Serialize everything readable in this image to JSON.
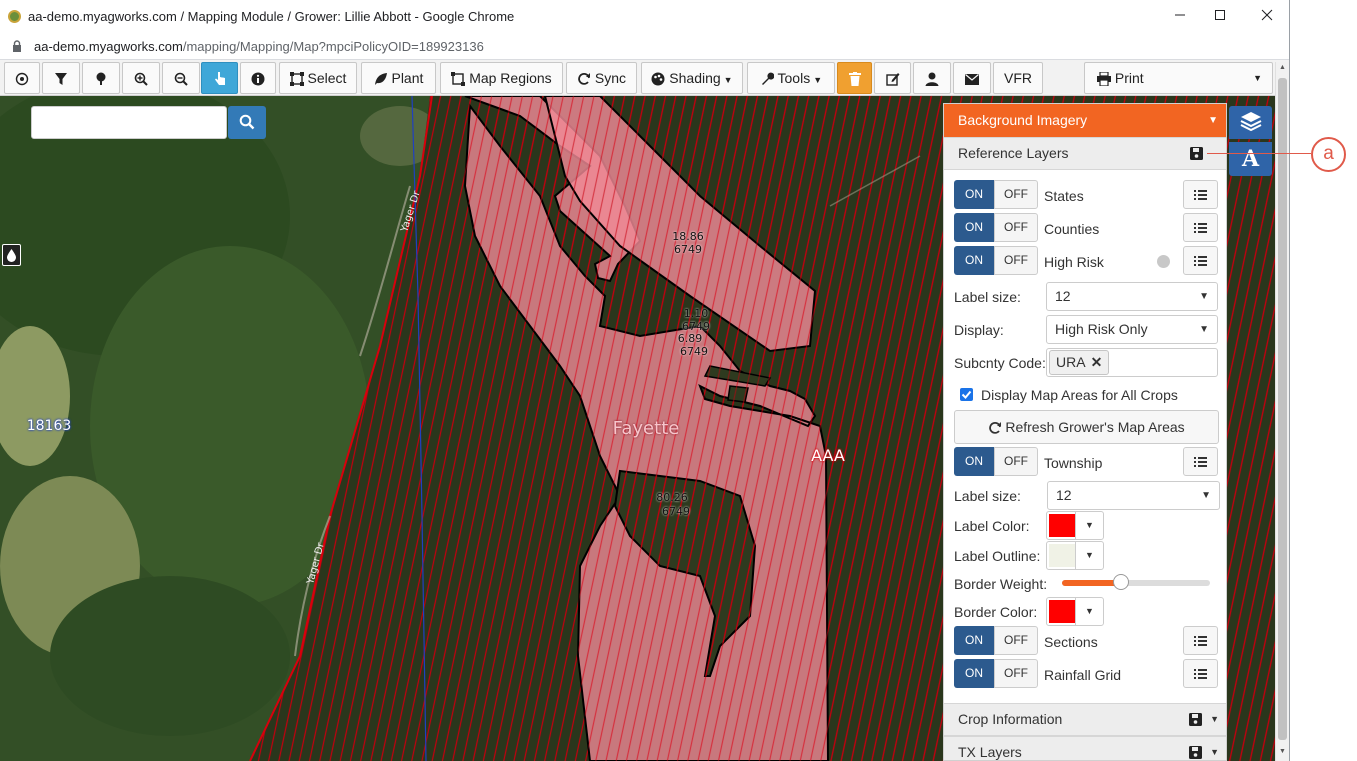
{
  "window": {
    "title": "aa-demo.myagworks.com / Mapping Module / Grower: Lillie Abbott - Google Chrome",
    "url_host": "aa-demo.myagworks.com",
    "url_path": "/mapping/Mapping/Map?mpciPolicyOID=189923136"
  },
  "toolbar": {
    "select": "Select",
    "plant": "Plant",
    "map_regions": "Map Regions",
    "sync": "Sync",
    "shading": "Shading",
    "tools": "Tools",
    "vfr": "VFR",
    "print": "Print"
  },
  "map": {
    "search_placeholder": "",
    "labels": {
      "f1": "18.86",
      "f1b": "6749",
      "f2": "1.10",
      "f2b": "6749",
      "f3": "6.89",
      "f3b": "6749",
      "f4": "80.26",
      "f4b": "6749",
      "county": "Fayette",
      "township": "AAA",
      "section": "18163",
      "road1": "Yager Dr",
      "road2": "Yager Dr"
    }
  },
  "panel": {
    "background_imagery": "Background Imagery",
    "reference_layers": "Reference Layers",
    "on": "ON",
    "off": "OFF",
    "layers": {
      "states": "States",
      "counties": "Counties",
      "high_risk": "High Risk",
      "township": "Township",
      "sections": "Sections",
      "rainfall_grid": "Rainfall Grid"
    },
    "label_size_label": "Label size:",
    "label_size_value": "12",
    "display_label": "Display:",
    "display_value": "High Risk Only",
    "subcnty_label": "Subcnty Code:",
    "subcnty_tag": "URA",
    "display_all_crops": "Display Map Areas for All Crops",
    "refresh_button": "Refresh Grower's Map Areas",
    "township_label_size_value": "12",
    "label_color_label": "Label Color:",
    "label_outline_label": "Label Outline:",
    "border_weight_label": "Border Weight:",
    "border_weight_value": 0.4,
    "border_color_label": "Border Color:",
    "crop_information": "Crop Information",
    "tx_layers": "TX Layers",
    "colors": {
      "label_color": "#ff0000",
      "label_outline": "#f0f2e6",
      "border_color": "#ff0000",
      "accent": "#f26522"
    }
  },
  "callout": {
    "letter": "a"
  }
}
